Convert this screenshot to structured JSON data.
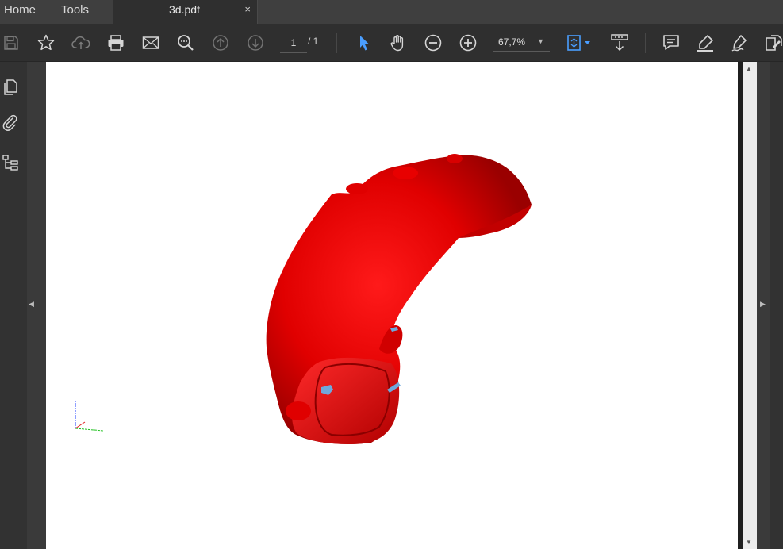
{
  "tabs": {
    "home": "Home",
    "tools": "Tools",
    "document": {
      "title": "3d.pdf",
      "close": "×"
    }
  },
  "toolbar": {
    "icons": [
      "save-icon",
      "bookmark-star-icon",
      "cloud-upload-icon",
      "print-icon",
      "email-icon",
      "search-zoom-icon",
      "page-up-icon",
      "page-down-icon",
      "select-arrow-icon",
      "hand-pan-icon",
      "zoom-out-icon",
      "zoom-in-icon",
      "fit-page-icon",
      "scrolling-mode-icon",
      "comment-icon",
      "highlight-pen-icon",
      "sign-icon",
      "edit-pdf-icon"
    ],
    "page_current": "1",
    "page_total": "/ 1",
    "zoom": "67,7%"
  },
  "left_rail": {
    "icons": [
      "page-thumbnails-icon",
      "attachments-icon",
      "model-tree-icon"
    ]
  },
  "colors": {
    "accent": "#4a9eff",
    "model_red": "#e30000",
    "model_blue": "#6fa8dc",
    "page_bg": "#ffffff",
    "ui_bg": "#323232"
  }
}
